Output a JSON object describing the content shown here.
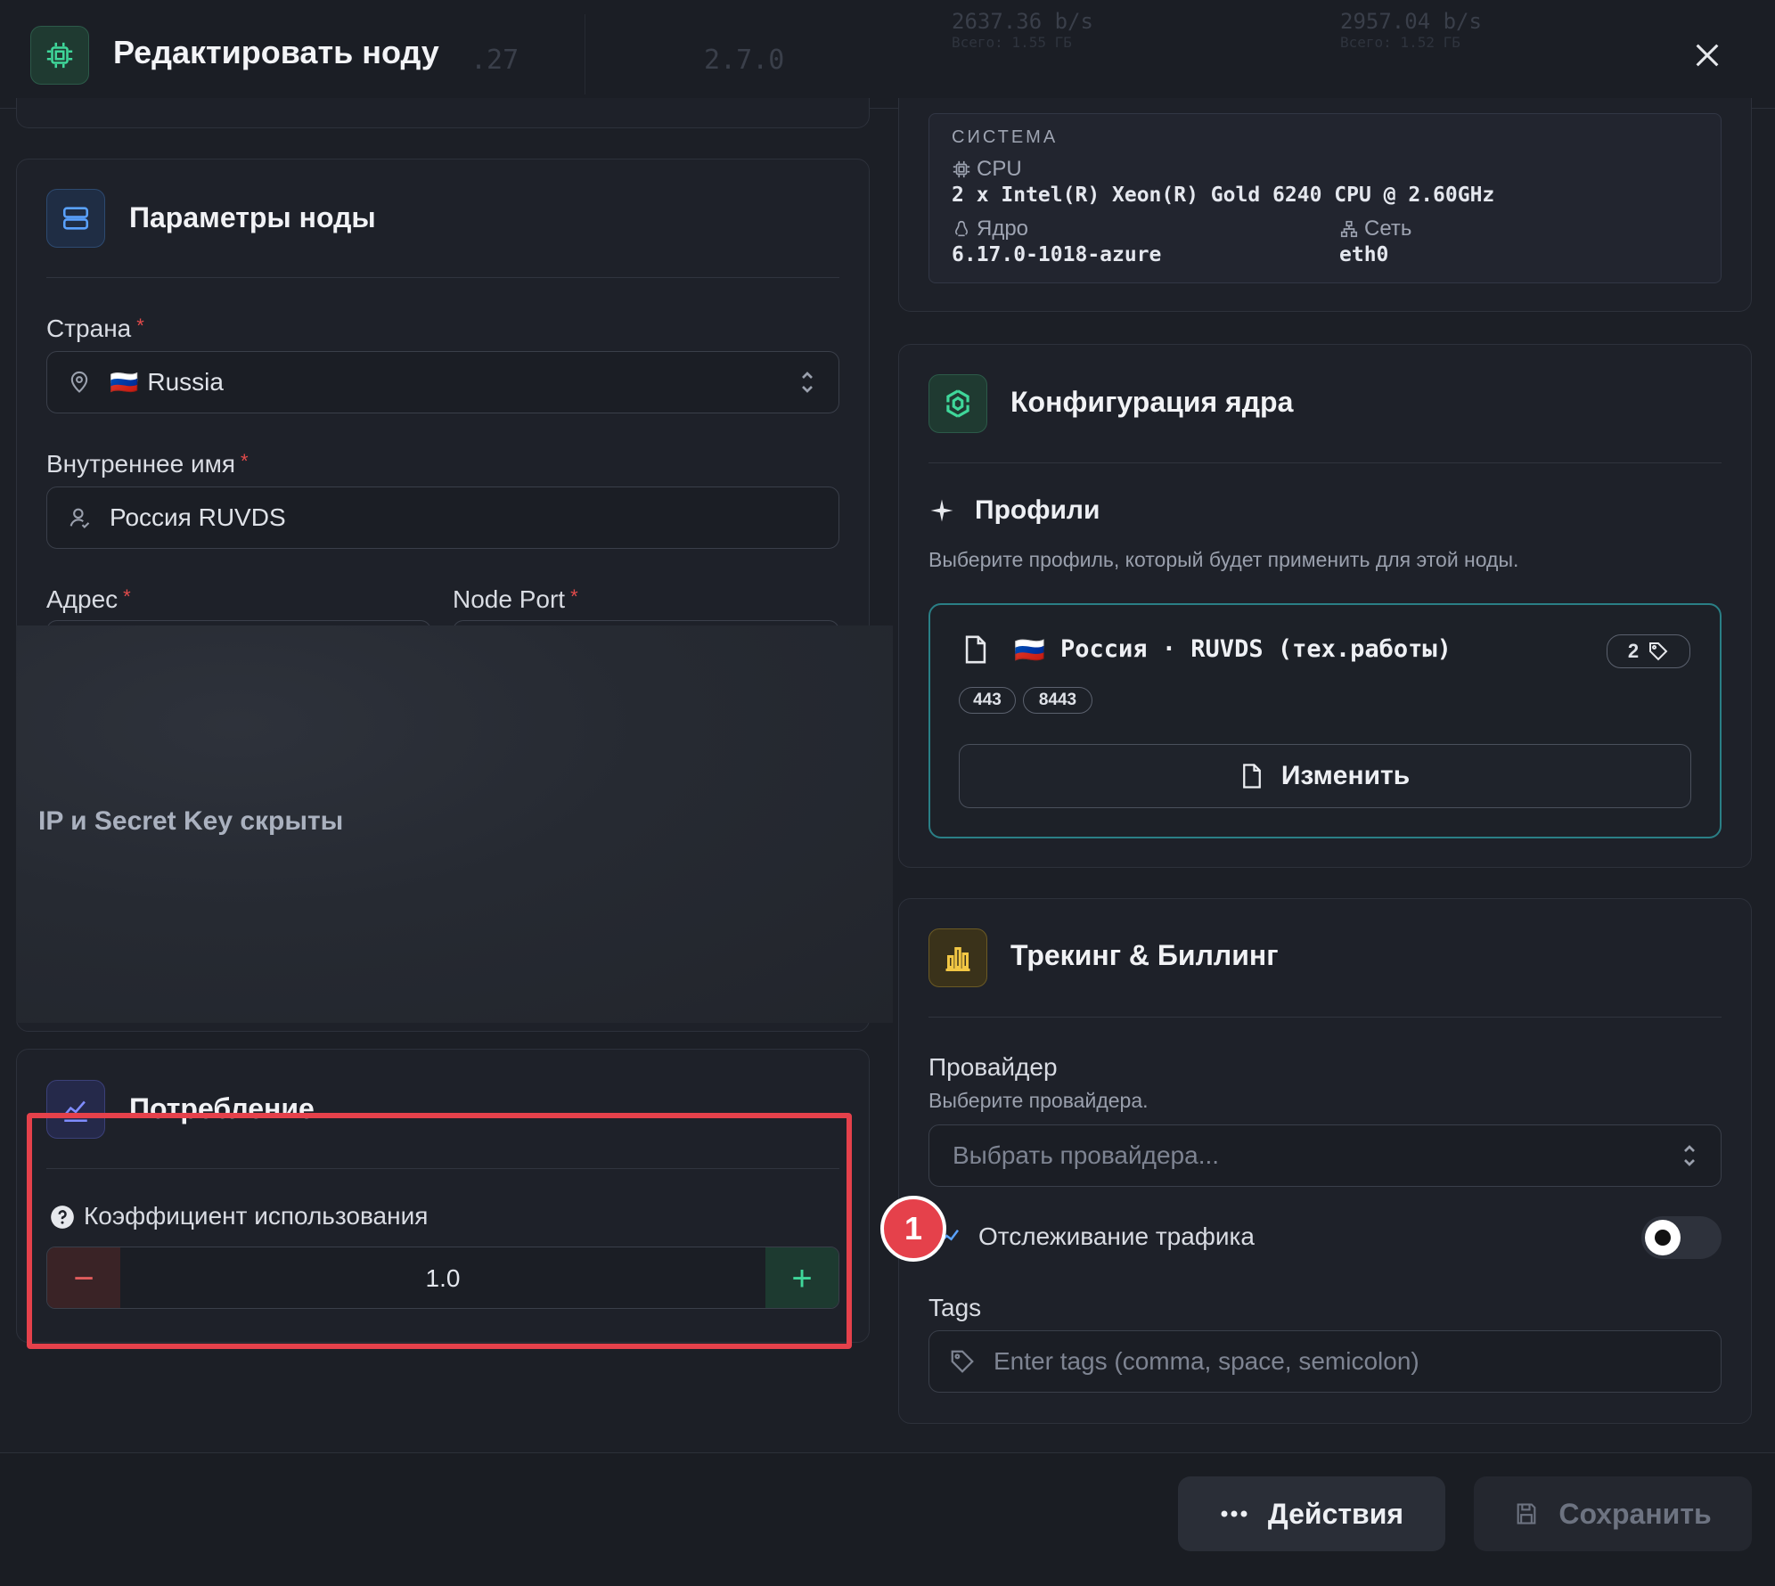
{
  "header": {
    "title": "Редактировать ноду",
    "ghost": {
      "rate_left": "2637.36 b/s",
      "rate_left_sub": "Всего: 1.55 ГБ",
      "rate_right": "2957.04 b/s",
      "rate_right_sub": "Всего: 1.52 ГБ",
      "val_a": ".27",
      "val_b": "2.7.0"
    }
  },
  "node_params": {
    "title": "Параметры ноды",
    "country": {
      "label": "Страна",
      "value": "Russia",
      "flag": "🇷🇺"
    },
    "internal_name": {
      "label": "Внутреннее имя",
      "value": "Россия RUVDS"
    },
    "address": {
      "label": "Адрес"
    },
    "node_port": {
      "label": "Node Port"
    },
    "hidden_notice": "IP и Secret Key скрыты"
  },
  "consumption": {
    "title": "Потребление",
    "coefficient_label": "Коэффициент использования",
    "coefficient_value": "1.0",
    "minus": "−",
    "plus": "+"
  },
  "system": {
    "heading": "СИСТЕМА",
    "cpu_label": "CPU",
    "cpu_value": "2 x Intel(R) Xeon(R) Gold 6240 CPU @ 2.60GHz",
    "kernel_label": "Ядро",
    "kernel_value": "6.17.0-1018-azure",
    "network_label": "Сеть",
    "network_value": "eth0"
  },
  "core_config": {
    "title": "Конфигурация ядра",
    "profiles_title": "Профили",
    "profiles_desc": "Выберите профиль, который будет применить для этой ноды.",
    "profile": {
      "flag": "🇷🇺",
      "name": "Россия · RUVDS (тех.работы)",
      "tag_count": "2",
      "ports": [
        "443",
        "8443"
      ],
      "edit_label": "Изменить"
    }
  },
  "tracking": {
    "title": "Трекинг & Биллинг",
    "provider_label": "Провайдер",
    "provider_hint": "Выберите провайдера.",
    "provider_placeholder": "Выбрать провайдера...",
    "traffic_label": "Отслеживание трафика",
    "traffic_enabled": false,
    "tags_label": "Tags",
    "tags_placeholder": "Enter tags (comma, space, semicolon)"
  },
  "annotation": {
    "callout_number": "1"
  },
  "footer": {
    "actions_label": "Действия",
    "save_label": "Сохранить"
  },
  "colors": {
    "accent_green": "#3fd79a",
    "accent_teal": "#2a7f86",
    "danger": "#e5414b",
    "required": "#e24b4b"
  }
}
